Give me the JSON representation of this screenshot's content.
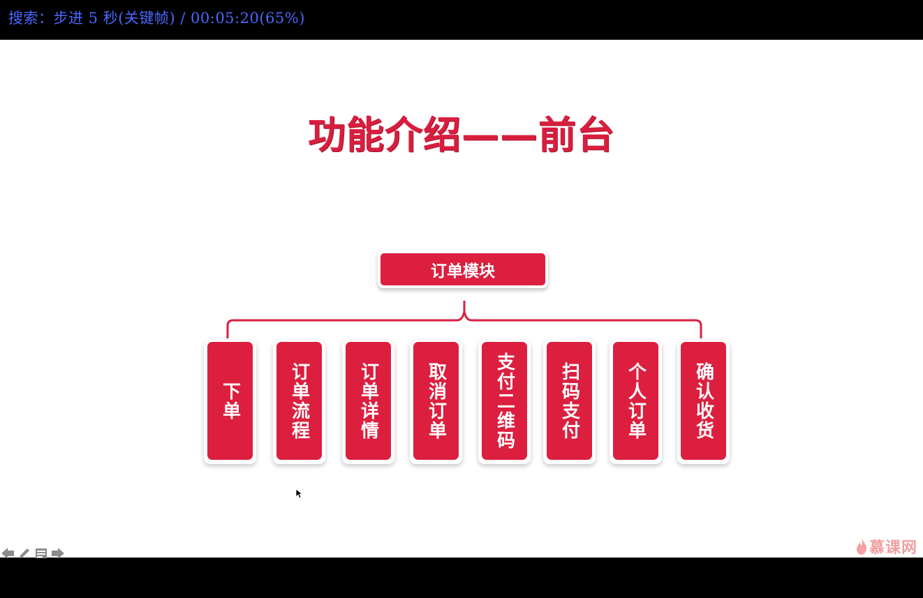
{
  "status_bar": {
    "text": "搜索：步进 5 秒(关键帧) / 00:05:20(65%)"
  },
  "slide": {
    "title": "功能介绍——前台",
    "module": "订单模块",
    "items": [
      {
        "label": "下单"
      },
      {
        "label": "订单流程"
      },
      {
        "label": "订单详情"
      },
      {
        "label": "取消订单"
      },
      {
        "label": "支付二维码"
      },
      {
        "label": "扫码支付"
      },
      {
        "label": "个人订单"
      },
      {
        "label": "确认收货"
      }
    ],
    "accent_color": "#dc1f3f"
  },
  "controls": {
    "icons": [
      "arrow-left-icon",
      "pen-icon",
      "menu-icon",
      "arrow-right-icon"
    ]
  },
  "watermark": {
    "text": "慕课网"
  }
}
